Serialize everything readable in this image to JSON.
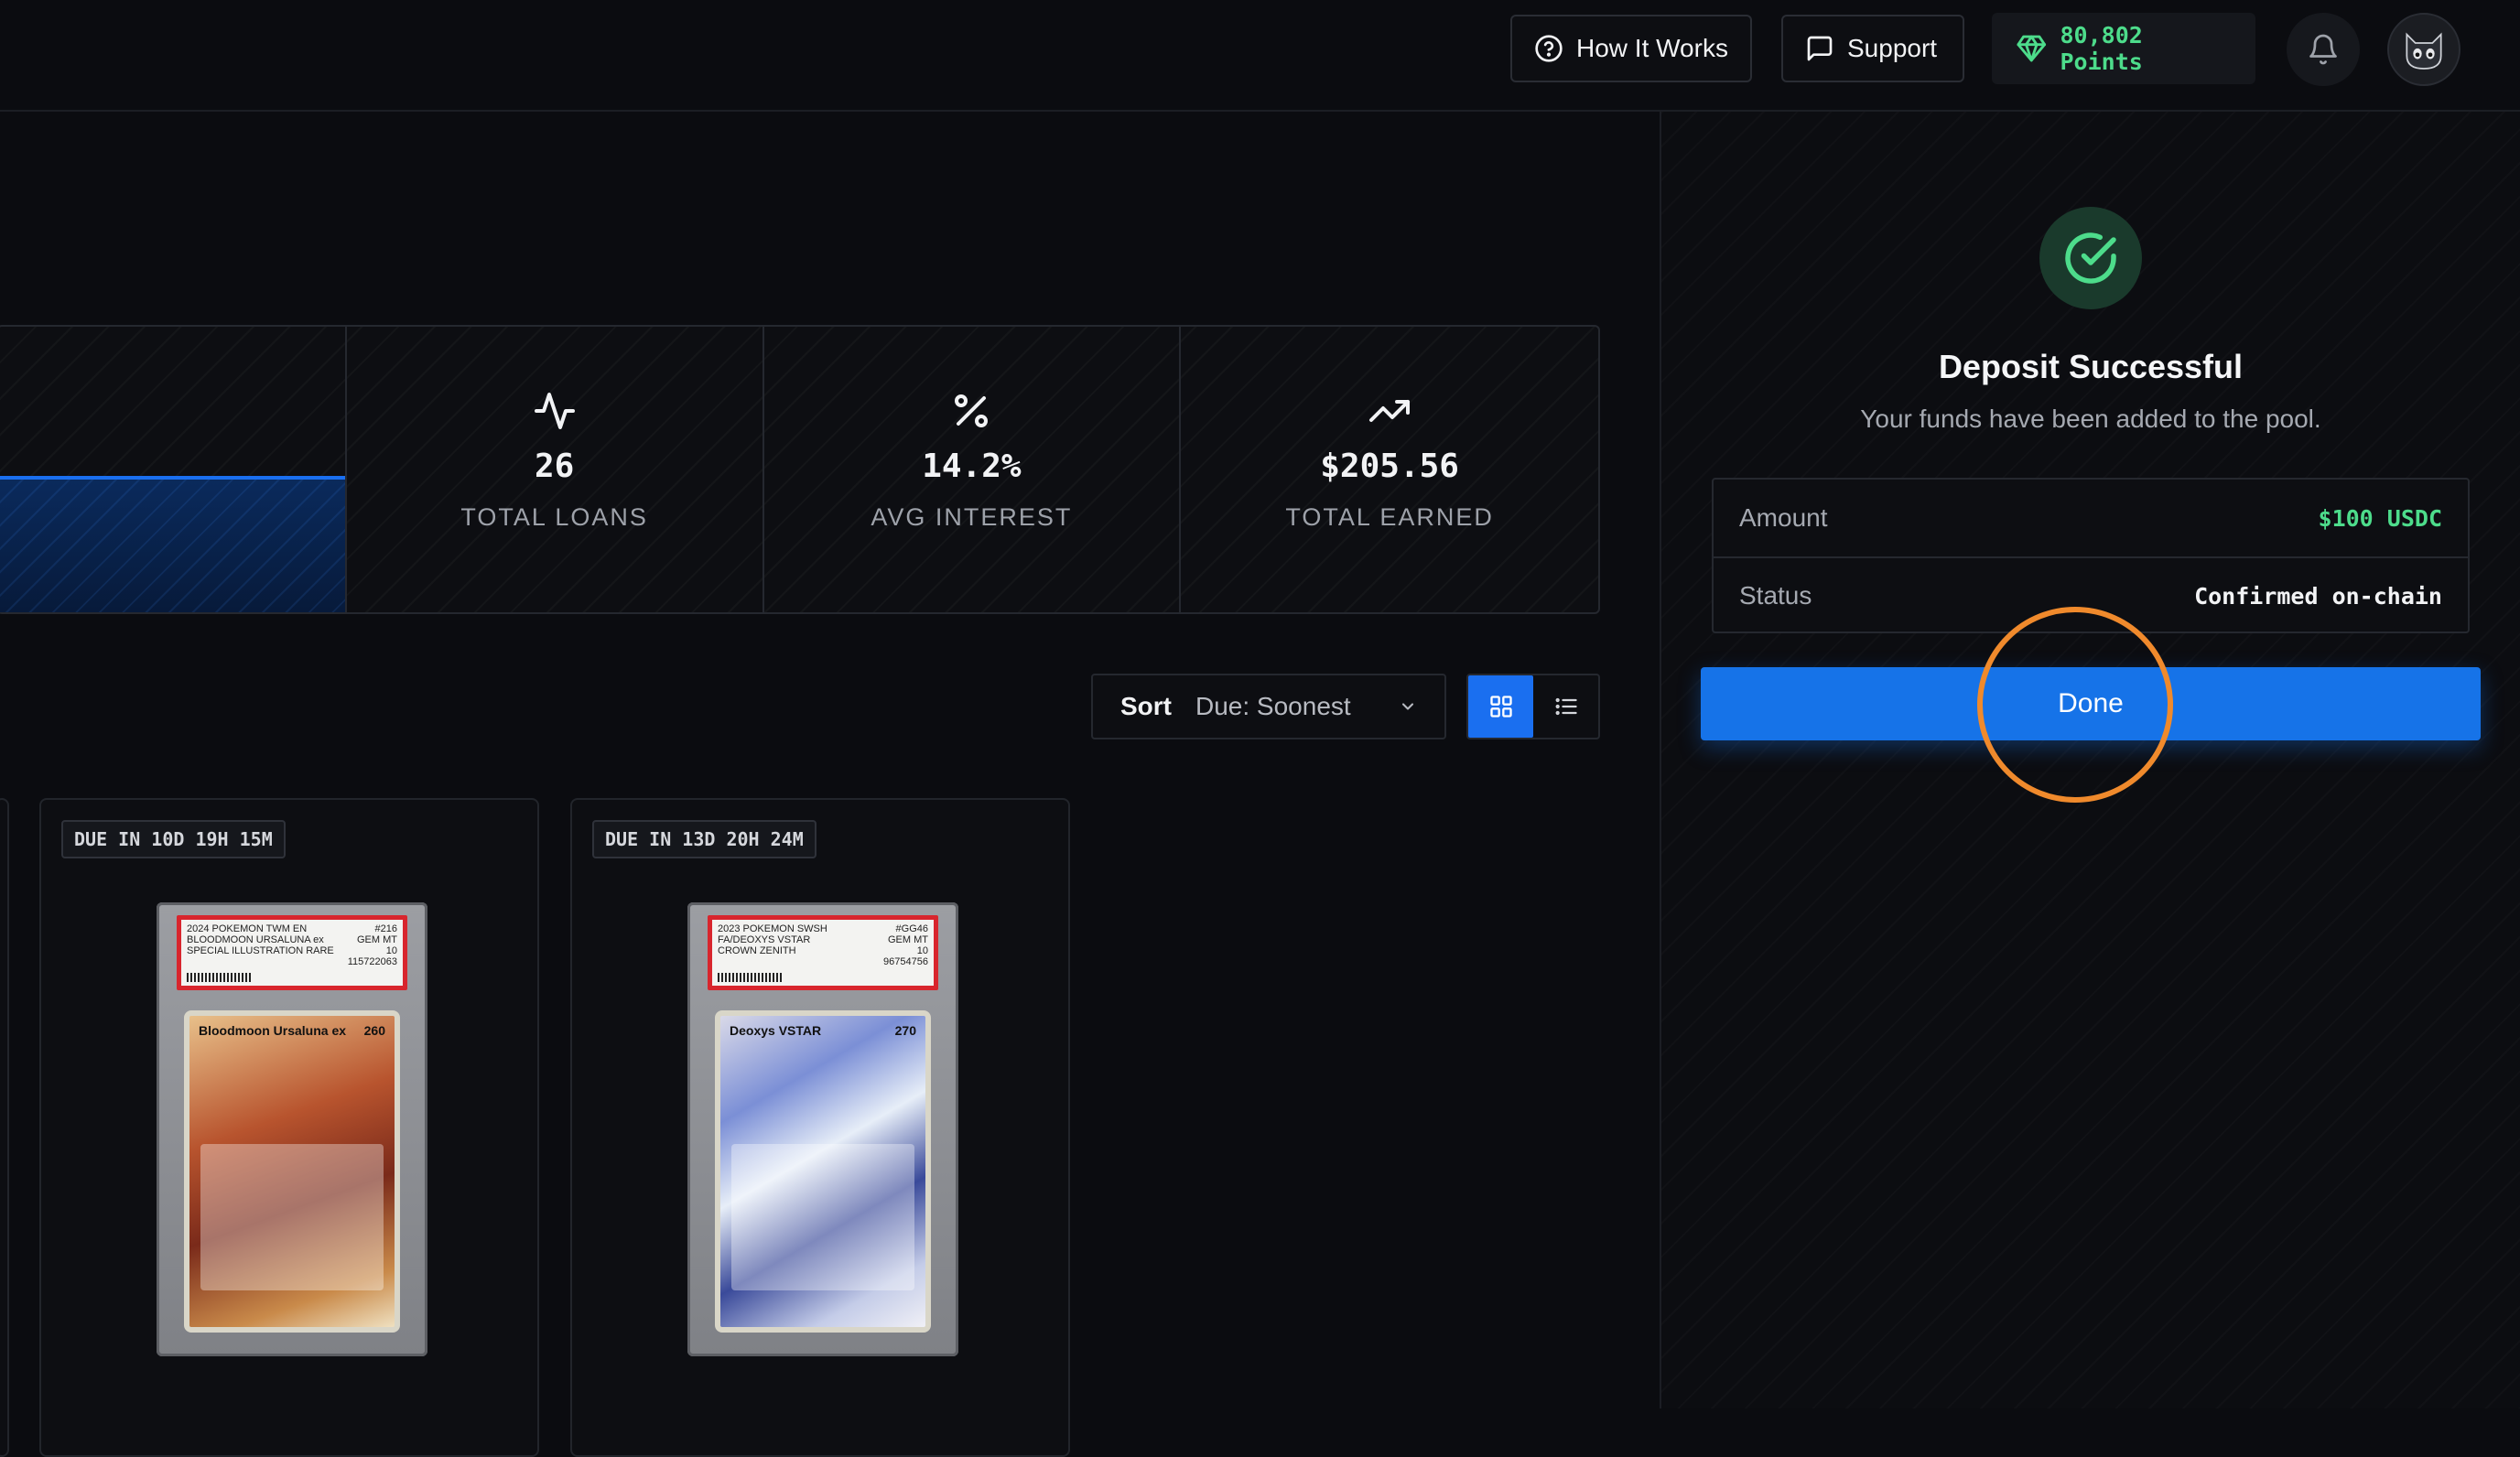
{
  "topbar": {
    "how_it_works": "How It Works",
    "support": "Support",
    "points": "80,802 Points"
  },
  "stats": [
    {
      "icon": "activity-icon",
      "value": "26",
      "label": "TOTAL LOANS"
    },
    {
      "icon": "percent-icon",
      "value": "14.2%",
      "label": "AVG INTEREST"
    },
    {
      "icon": "trending-up-icon",
      "value": "$205.56",
      "label": "TOTAL EARNED"
    }
  ],
  "sort": {
    "label": "Sort",
    "value": "Due: Soonest",
    "view_mode": "grid"
  },
  "cards": [
    {
      "due": "DUE IN 10D 19H 15M",
      "slab_label_left": "2024 POKEMON TWM EN\nBLOODMOON URSALUNA ex\nSPECIAL ILLUSTRATION RARE",
      "slab_label_right": "#216\nGEM MT\n10\n115722063",
      "card_name": "Bloodmoon Ursaluna ex",
      "hp": "260"
    },
    {
      "due": "DUE IN 13D 20H 24M",
      "slab_label_left": "2023 POKEMON SWSH\nFA/DEOXYS VSTAR\nCROWN ZENITH",
      "slab_label_right": "#GG46\nGEM MT\n10\n96754756",
      "card_name": "Deoxys VSTAR",
      "hp": "270"
    }
  ],
  "deposit": {
    "title": "Deposit Successful",
    "subtitle": "Your funds have been added to the pool.",
    "amount_label": "Amount",
    "amount_value": "$100 USDC",
    "status_label": "Status",
    "status_value": "Confirmed on-chain",
    "done_label": "Done"
  },
  "colors": {
    "accent": "#1673e8",
    "success": "#4ddc8b",
    "background": "#0b0c10",
    "click_marker": "#f08a2c"
  }
}
